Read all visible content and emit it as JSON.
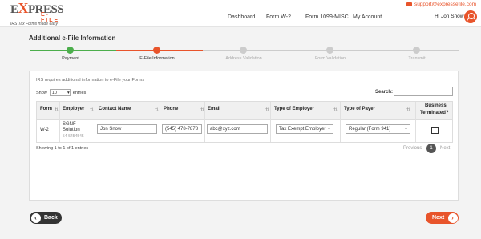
{
  "brand": {
    "logo_prefix": "E",
    "logo_x": "X",
    "logo_rest": "PRESS",
    "logo_sub": "E-FILE",
    "tagline": "IRS Tax Forms made easy"
  },
  "header": {
    "support_email": "support@expressefile.com",
    "nav": [
      "Dashboard",
      "Form W-2",
      "Form 1099-MISC",
      "My Account"
    ],
    "greeting": "Hi Jon Snow"
  },
  "page_title": "Additional e-File Information",
  "steps": [
    {
      "label": "Payment",
      "status": "done"
    },
    {
      "label": "E-File Information",
      "status": "active"
    },
    {
      "label": "Address Validation",
      "status": "pending"
    },
    {
      "label": "Form Validation",
      "status": "pending"
    },
    {
      "label": "Transmit",
      "status": "pending"
    }
  ],
  "panel": {
    "info": "IRS requires additional information to e-File your Forms",
    "show_label": "Show",
    "entries_value": "10",
    "entries_label": "entries",
    "search_label": "Search:"
  },
  "table": {
    "headers": [
      "Form",
      "Employer",
      "Contact Name",
      "Phone",
      "Email",
      "Type of Employer",
      "Type of Payer",
      "Business",
      "Terminated?"
    ],
    "row": {
      "form": "W-2",
      "employer_l1": "SGNF",
      "employer_l2": "Solution",
      "employer_id": "54-5454545",
      "contact": "Jon Snow",
      "phone": "(545) 478-7878",
      "email": "abc@xyz.com",
      "employer_type": "Tax Exempt Employer",
      "payer_type": "Regular (Form 941)"
    }
  },
  "footer": {
    "showing": "Showing 1 to 1 of 1 entries",
    "prev": "Previous",
    "page": "1",
    "next": "Next"
  },
  "buttons": {
    "back": "Back",
    "next": "Next"
  },
  "colors": {
    "accent": "#e8542b",
    "done": "#4cae4c",
    "pending": "#cccccc"
  }
}
